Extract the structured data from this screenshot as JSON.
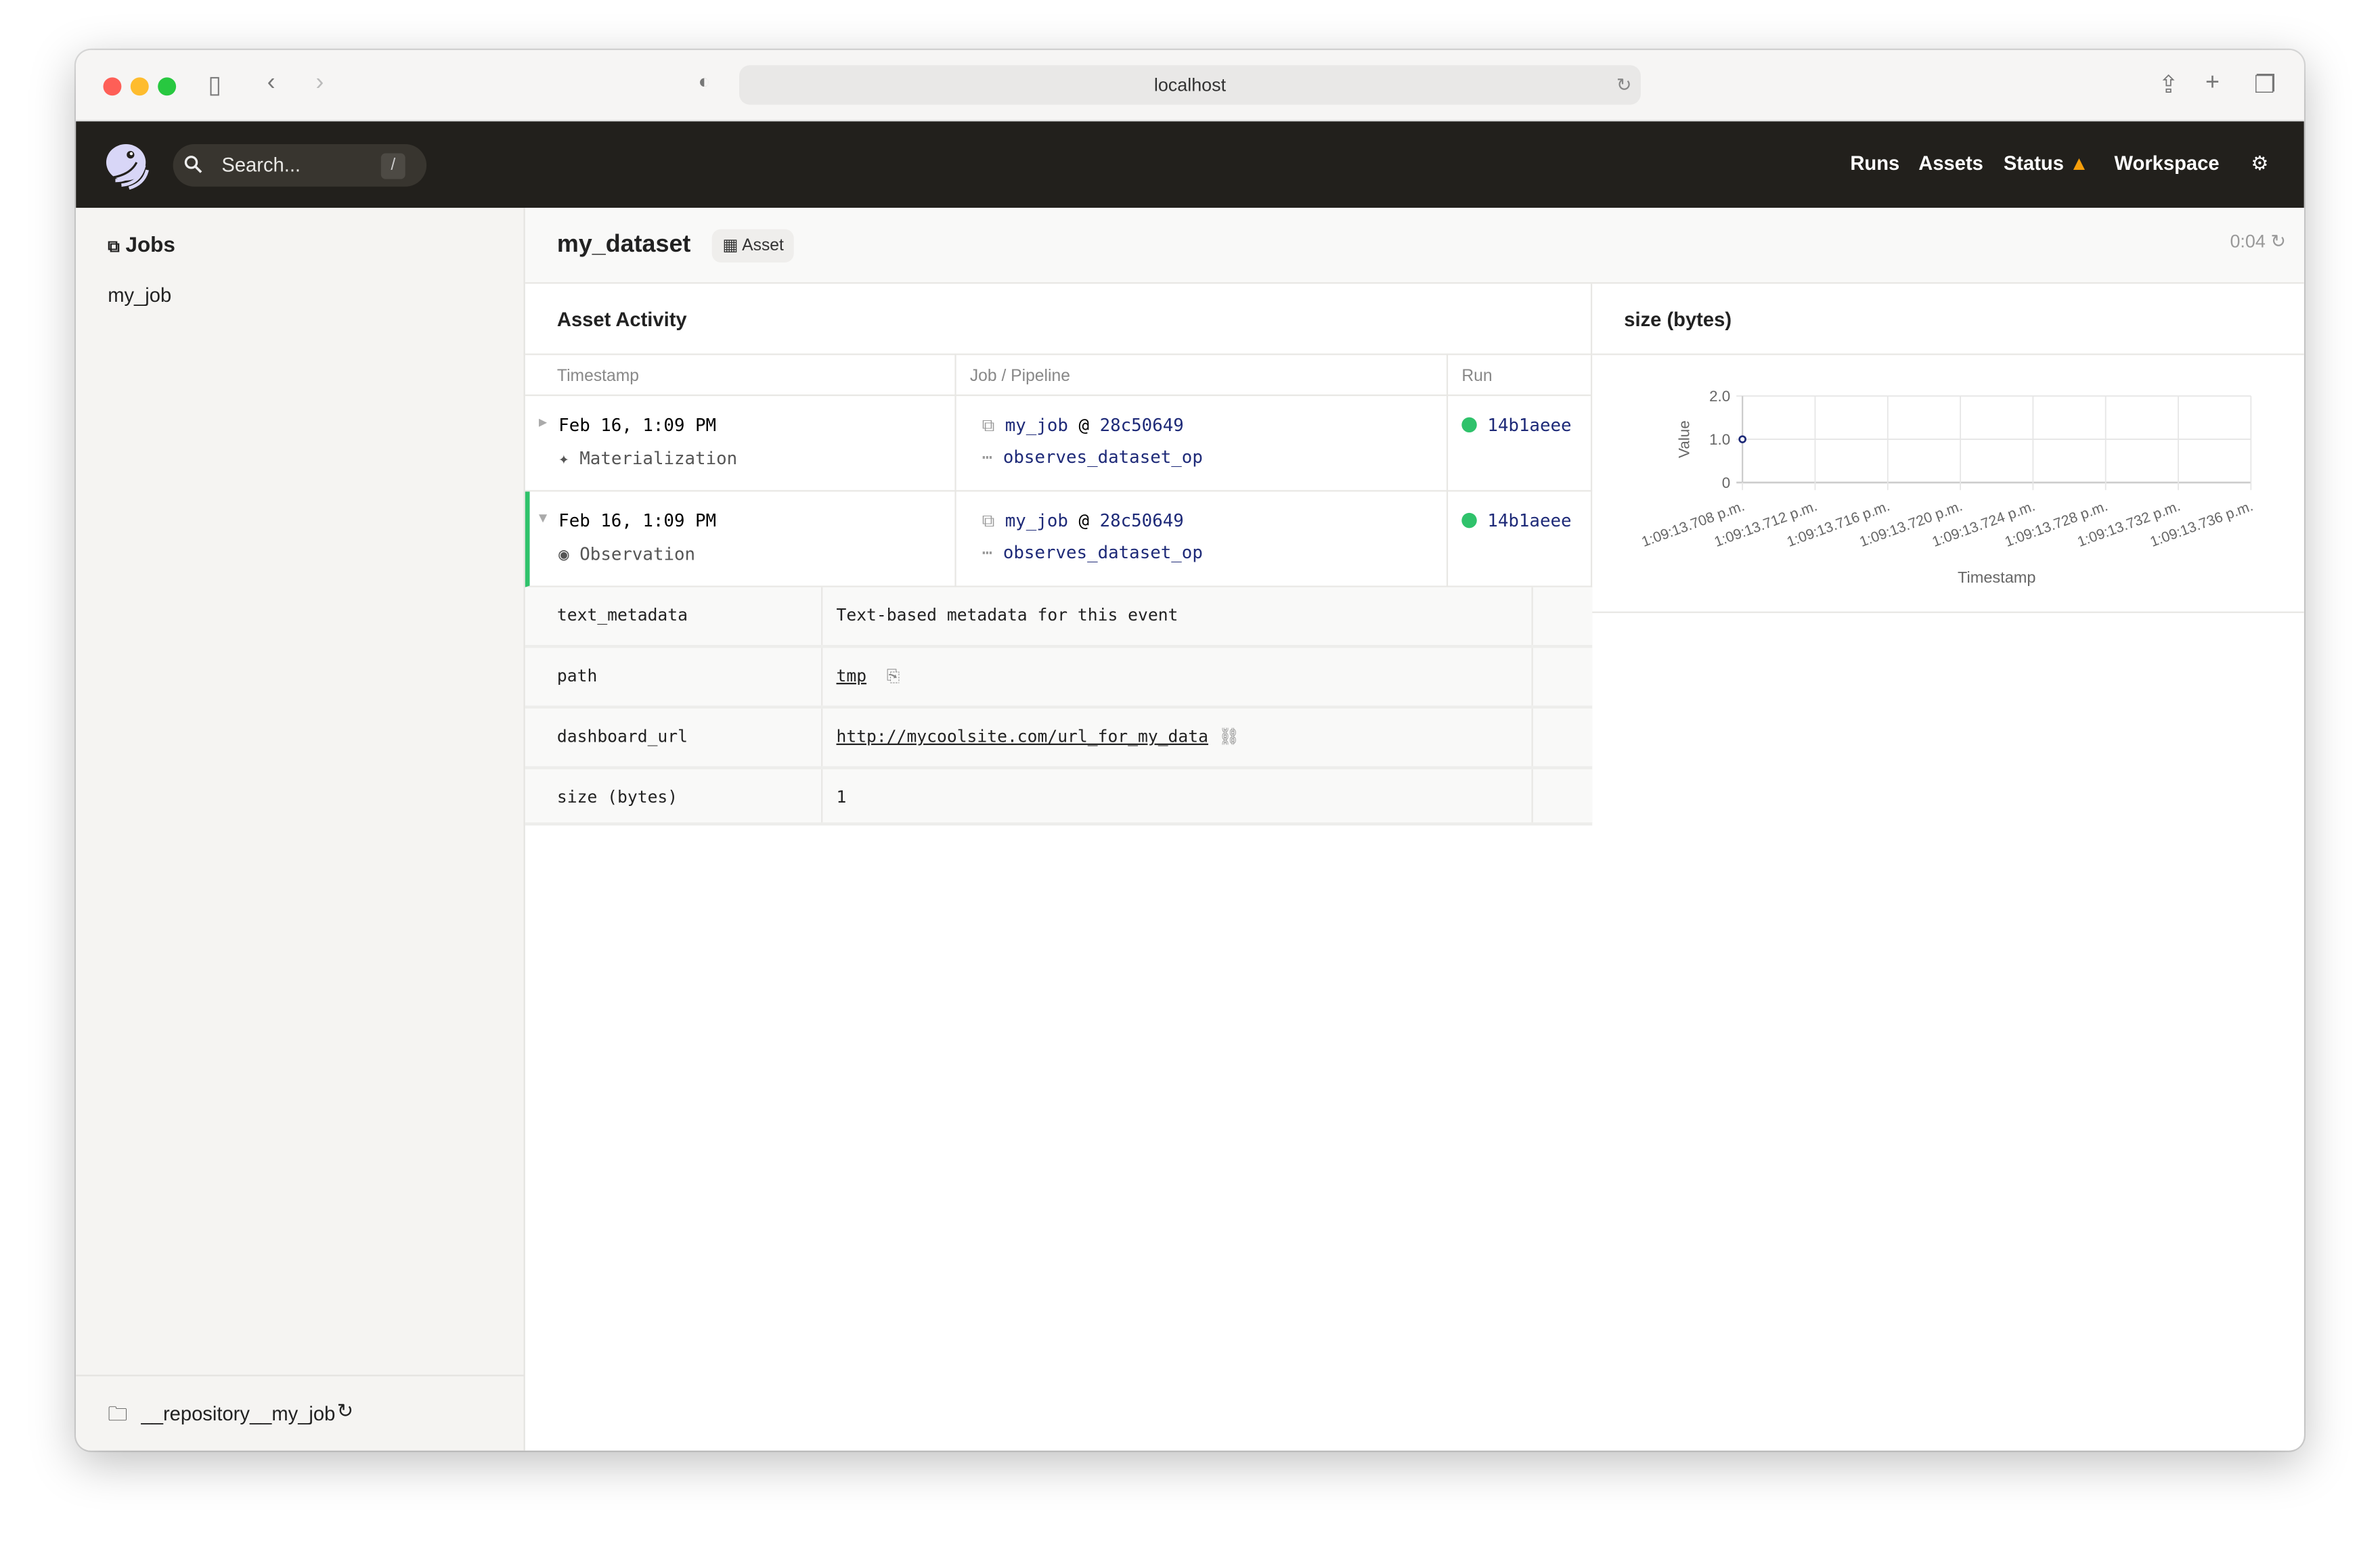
{
  "browser": {
    "url": "localhost"
  },
  "nav": {
    "search_placeholder": "Search...",
    "search_shortcut": "/",
    "runs": "Runs",
    "assets": "Assets",
    "status": "Status",
    "workspace": "Workspace",
    "warning_color": "#f59e0b"
  },
  "sidebar": {
    "title": "Jobs",
    "items": [
      {
        "label": "my_job"
      }
    ],
    "repository": "__repository__my_job"
  },
  "header": {
    "title": "my_dataset",
    "badge": "Asset",
    "timer": "0:04"
  },
  "activity": {
    "title": "Asset Activity",
    "columns": [
      "Timestamp",
      "Job / Pipeline",
      "Run"
    ],
    "rows": [
      {
        "timestamp": "Feb 16, 1:09 PM",
        "type": "Materialization",
        "job": "my_job",
        "at": "@",
        "snapshot": "28c50649",
        "op": "observes_dataset_op",
        "run": "14b1aeee",
        "expanded": false
      },
      {
        "timestamp": "Feb 16, 1:09 PM",
        "type": "Observation",
        "job": "my_job",
        "at": "@",
        "snapshot": "28c50649",
        "op": "observes_dataset_op",
        "run": "14b1aeee",
        "expanded": true
      }
    ],
    "metadata": [
      {
        "key": "text_metadata",
        "value": "Text-based metadata for this event"
      },
      {
        "key": "path",
        "value": "tmp"
      },
      {
        "key": "dashboard_url",
        "value": "http://mycoolsite.com/url_for_my_data"
      },
      {
        "key": "size (bytes)",
        "value": "1"
      }
    ],
    "success_color": "#2fc26b"
  },
  "chart_data": {
    "type": "scatter",
    "title": "size (bytes)",
    "xlabel": "Timestamp",
    "ylabel": "Value",
    "ylim": [
      0,
      2
    ],
    "yticks": [
      "0",
      "1.0",
      "2.0"
    ],
    "xticks": [
      "1:09:13.708 p.m.",
      "1:09:13.712 p.m.",
      "1:09:13.716 p.m.",
      "1:09:13.720 p.m.",
      "1:09:13.724 p.m.",
      "1:09:13.728 p.m.",
      "1:09:13.732 p.m.",
      "1:09:13.736 p.m."
    ],
    "points": [
      {
        "x": "1:09:13.708 p.m.",
        "y": 1
      }
    ],
    "grid": true,
    "color": "#1e2a78"
  }
}
